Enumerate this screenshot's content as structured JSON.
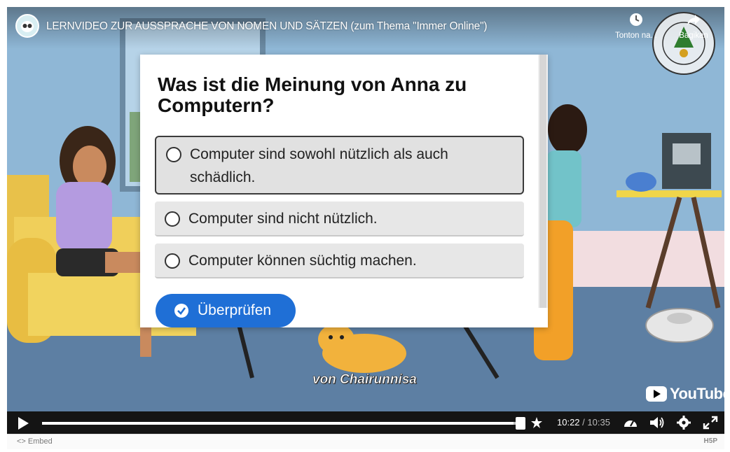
{
  "video": {
    "title": "LERNVIDEO ZUR AUSSPRACHE VON NOMEN UND SÄTZEN (zum Thema \"Immer Online\")",
    "watch_later_label": "Tonton na...",
    "share_label": "Bagikan",
    "author_caption": "von Chairunnisa",
    "youtube_logo_text": "YouTube",
    "seal_text": "UNIVERSITAS NEGERI MEDAN · UNIMED"
  },
  "quiz": {
    "question": "Was ist die Meinung von Anna zu Computern?",
    "options": [
      {
        "label": "Computer sind sowohl nützlich als auch schädlich.",
        "selected": true
      },
      {
        "label": "Computer sind nicht nützlich.",
        "selected": false
      },
      {
        "label": "Computer können süchtig machen.",
        "selected": false
      }
    ],
    "check_button_label": "Überprüfen"
  },
  "controls": {
    "current_time": "10:22",
    "separator": " / ",
    "duration": "10:35",
    "progress_fraction": 0.978
  },
  "footer": {
    "embed_label": "<> Embed",
    "h5p_label": "H5P"
  },
  "colors": {
    "accent": "#1f6fd6",
    "control_bar": "#141414",
    "wall": "#8fb7d6",
    "floor": "#5d7fa3"
  }
}
